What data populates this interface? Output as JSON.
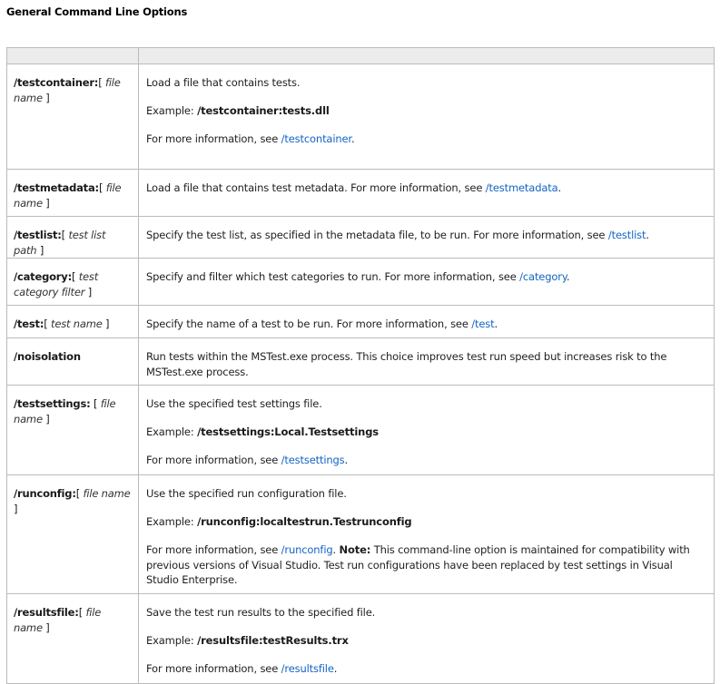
{
  "page": {
    "title": "General Command Line Options"
  },
  "table": {
    "rows": [
      {
        "name": "/testcontainer:",
        "arg_open": "[",
        "arg": "file name",
        "arg_close": "]",
        "description": "Load a file that contains tests.",
        "example_label": "Example: ",
        "example_value": "/testcontainer:tests.dll",
        "info_prefix": "For more information, see ",
        "link": "/testcontainer",
        "info_suffix": "."
      },
      {
        "name": "/testmetadata:",
        "arg_open": "[",
        "arg": "file name",
        "arg_close": "]",
        "description_prefix": "Load a file that contains test metadata. For more information, see ",
        "link": "/testmetadata",
        "description_suffix": "."
      },
      {
        "name": "/testlist:",
        "arg_open": "[",
        "arg": "test list path",
        "arg_close": "]",
        "description_prefix": "Specify the test list, as specified in the metadata file, to be run. For more information, see ",
        "link": "/testlist",
        "description_suffix": "."
      },
      {
        "name": "/category:",
        "arg_open": "[",
        "arg": "test category filter",
        "arg_close": "]",
        "description_prefix": "Specify and filter which test categories to run. For more information, see ",
        "link": "/category",
        "description_suffix": "."
      },
      {
        "name": "/test:",
        "arg_open": "[",
        "arg": "test name",
        "arg_close": "]",
        "description_prefix": "Specify the name of a test to be run. For more information, see ",
        "link": "/test",
        "description_suffix": "."
      },
      {
        "name": "/noisolation",
        "description": "Run tests within the MSTest.exe process. This choice improves test run speed but increases risk to the MSTest.exe process."
      },
      {
        "name": "/testsettings:",
        "arg_open": " [",
        "arg": "file name",
        "arg_close": "]",
        "description": "Use the specified test settings file.",
        "example_label": "Example: ",
        "example_value": "/testsettings:Local.Testsettings",
        "info_prefix": "For more information, see ",
        "link": "/testsettings",
        "info_suffix": "."
      },
      {
        "name": "/runconfig:",
        "arg_open": "[",
        "arg": "file name",
        "arg_close": "]",
        "description": "Use the specified run configuration file.",
        "example_label": "Example: ",
        "example_value": "/runconfig:localtestrun.Testrunconfig",
        "info_prefix": "For more information, see ",
        "link": "/runconfig",
        "info_suffix": ". ",
        "note_label": "Note:",
        "note_text": " This command-line option is maintained for compatibility with previous versions of Visual Studio. Test run configurations have been replaced by test settings in Visual Studio Enterprise."
      },
      {
        "name": "/resultsfile:",
        "arg_open": "[",
        "arg": "file name",
        "arg_close": "]",
        "description": "Save the test run results to the specified file.",
        "example_label": "Example: ",
        "example_value": "/resultsfile:testResults.trx",
        "info_prefix": "For more information, see ",
        "link": "/resultsfile",
        "info_suffix": "."
      }
    ]
  }
}
